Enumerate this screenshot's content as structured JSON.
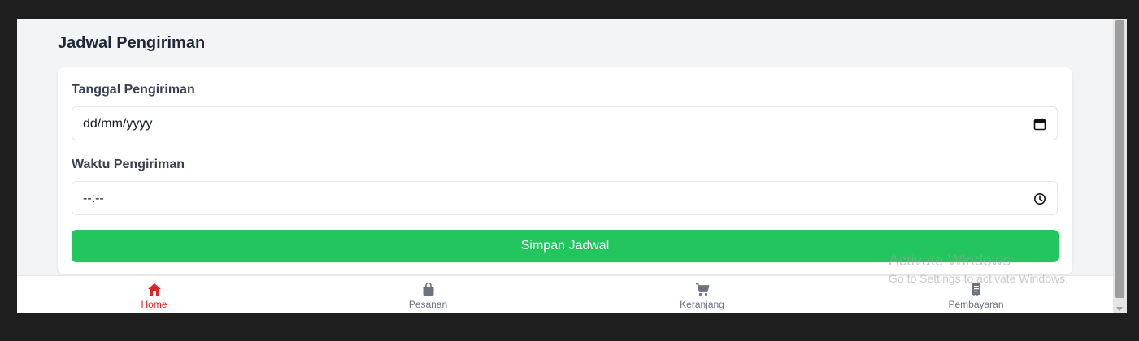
{
  "page": {
    "title": "Jadwal Pengiriman"
  },
  "form": {
    "date_label": "Tanggal Pengiriman",
    "date_value": "dd/mm/yyyy",
    "date_icon": "calendar-icon",
    "time_label": "Waktu Pengiriman",
    "time_value": "--:--",
    "time_icon": "clock-icon",
    "save_label": "Simpan Jadwal"
  },
  "bottom_nav": {
    "items": [
      {
        "label": "Home",
        "icon": "home-icon",
        "active": true
      },
      {
        "label": "Pesanan",
        "icon": "bag-icon",
        "active": false
      },
      {
        "label": "Keranjang",
        "icon": "cart-icon",
        "active": false
      },
      {
        "label": "Pembayaran",
        "icon": "receipt-icon",
        "active": false
      }
    ]
  },
  "watermark": {
    "line1": "Activate Windows",
    "line2": "Go to Settings to activate Windows."
  },
  "colors": {
    "accent_green": "#22c55e",
    "active_red": "#dc2626",
    "inactive_gray": "#6b7280",
    "background": "#f3f4f6"
  }
}
